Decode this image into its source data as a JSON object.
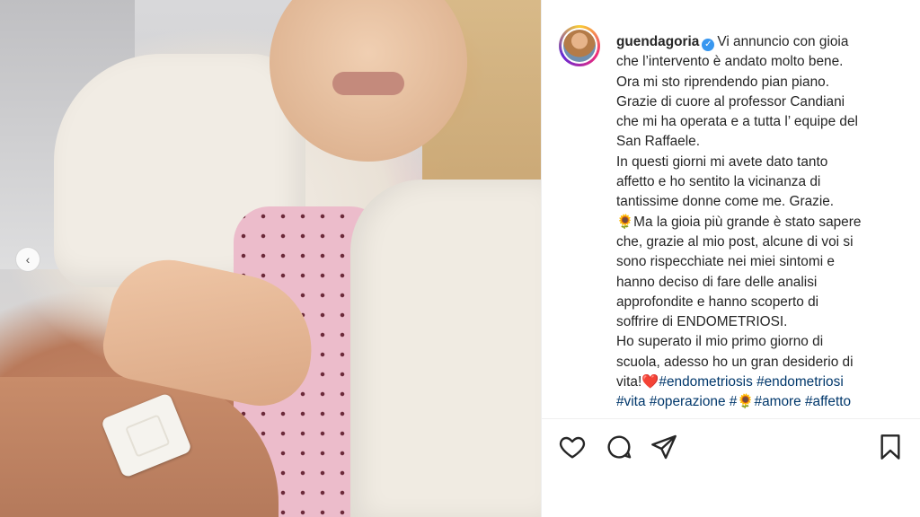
{
  "post": {
    "username": "guendagoria",
    "verified": true,
    "caption_lines": [
      "Vi annuncio con gioia",
      "che l’intervento è andato molto bene.",
      "Ora mi sto riprendendo pian piano.",
      "Grazie di cuore al professor Candiani",
      "che mi ha operata e a tutta l’ equipe del",
      "San Raffaele.",
      "In questi giorni mi avete dato tanto",
      "affetto e ho sentito la vicinanza di",
      "tantissime donne come me. Grazie.",
      "Ma la gioia più grande è stato sapere",
      "che, grazie al mio post, alcune di voi si",
      "sono rispecchiate nei miei sintomi e",
      "hanno deciso di fare delle analisi",
      "approfondite e hanno scoperto di",
      "soffrire di ENDOMETRIOSI.",
      "Ho superato il mio primo giorno di",
      "scuola, adesso ho un gran desiderio di",
      "vita!"
    ],
    "emoji": {
      "sunflower": "🌻",
      "heart": "❤️"
    },
    "hashtags": {
      "line1": [
        "#endometriosis",
        "#endometriosi"
      ],
      "line2a": [
        "#vita",
        "#operazione",
        "#"
      ],
      "line2b": [
        "#amore",
        "#affetto"
      ]
    }
  },
  "actions": {
    "like": "heart-icon",
    "comment": "comment-icon",
    "share": "share-icon",
    "save": "bookmark-icon"
  },
  "carousel": {
    "prev": "‹"
  }
}
